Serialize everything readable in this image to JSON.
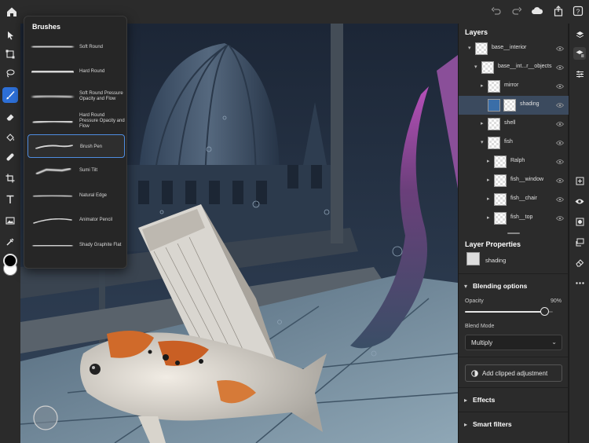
{
  "brushes": {
    "title": "Brushes",
    "items": [
      {
        "label": "Soft Round"
      },
      {
        "label": "Hard Round"
      },
      {
        "label": "Soft Round Pressure Opacity and Flow"
      },
      {
        "label": "Hard Round Pressure Opacity and Flow"
      },
      {
        "label": "Brush Pen",
        "selected": true
      },
      {
        "label": "Sumi Tilt"
      },
      {
        "label": "Natural Edge"
      },
      {
        "label": "Animator Pencil"
      },
      {
        "label": "Shady Graphite Flat"
      }
    ]
  },
  "layers": {
    "title": "Layers",
    "items": [
      {
        "name": "base__interior",
        "caret": "▾"
      },
      {
        "name": "base__int...r__objects",
        "caret": "▾"
      },
      {
        "name": "mirror",
        "caret": "▸"
      },
      {
        "name": "shading",
        "caret": "",
        "selected": true
      },
      {
        "name": "shell",
        "caret": "▸"
      },
      {
        "name": "fish",
        "caret": "▾"
      },
      {
        "name": "Ralph",
        "caret": "▸"
      },
      {
        "name": "fish__window",
        "caret": "▸"
      },
      {
        "name": "fish__chair",
        "caret": "▸"
      },
      {
        "name": "fish__top",
        "caret": "▸"
      }
    ]
  },
  "layer_properties": {
    "title": "Layer Properties",
    "layer_name": "shading"
  },
  "blending": {
    "title": "Blending options",
    "opacity_label": "Opacity",
    "opacity_value": "90%",
    "opacity_fraction": 0.9,
    "blend_mode_label": "Blend Mode",
    "blend_mode_value": "Multiply"
  },
  "clipped_adjustment": {
    "label": "Add clipped adjustment"
  },
  "effects": {
    "label": "Effects"
  },
  "smart_filters": {
    "label": "Smart filters"
  },
  "colors": {
    "accent": "#2d6fd6",
    "foreground": "#000000",
    "background": "#ffffff",
    "panel_bg": "#2b2b2b"
  }
}
